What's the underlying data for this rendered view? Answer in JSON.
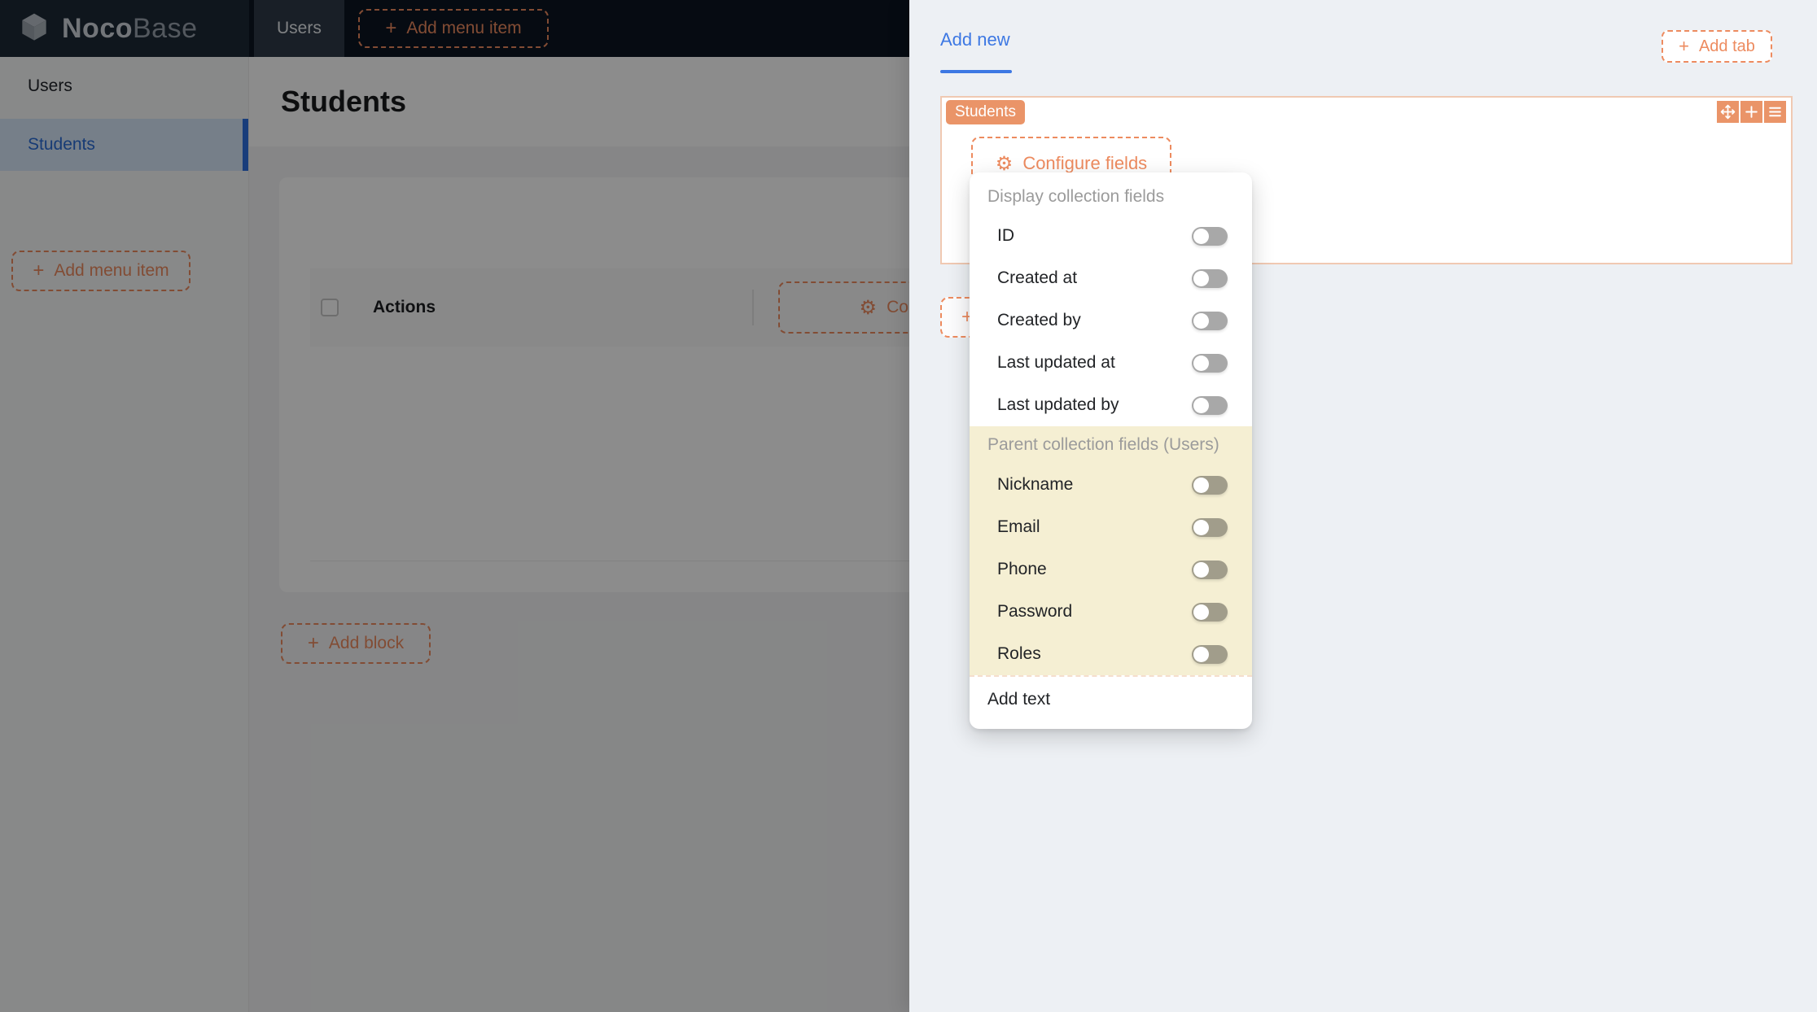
{
  "navbar": {
    "logo_bold": "Noco",
    "logo_light": "Base",
    "users_tab": "Users",
    "add_menu_item_label": "Add menu item"
  },
  "sidebar": {
    "items": [
      "Users",
      "Students"
    ],
    "selected_item": "Students",
    "add_menu_item_label": "Add menu item"
  },
  "main": {
    "page_title": "Students",
    "table": {
      "actions_header": "Actions",
      "configure_columns_label": "Configure c"
    },
    "add_block_label": "Add block"
  },
  "drawer": {
    "active_tab": "Add new",
    "add_tab_label": "Add tab",
    "block_badge": "Students",
    "configure_fields_label": "Configure fields"
  },
  "dropdown": {
    "section1": {
      "title": "Display collection fields",
      "items": [
        {
          "label": "ID",
          "enabled": false
        },
        {
          "label": "Created at",
          "enabled": false
        },
        {
          "label": "Created by",
          "enabled": false
        },
        {
          "label": "Last updated at",
          "enabled": false
        },
        {
          "label": "Last updated by",
          "enabled": false
        }
      ]
    },
    "section2": {
      "title": "Parent collection fields (Users)",
      "items": [
        {
          "label": "Nickname",
          "enabled": false
        },
        {
          "label": "Email",
          "enabled": false
        },
        {
          "label": "Phone",
          "enabled": false
        },
        {
          "label": "Password",
          "enabled": false
        },
        {
          "label": "Roles",
          "enabled": false
        }
      ]
    },
    "add_text_label": "Add text"
  },
  "icons": {
    "plus": "+",
    "gear": "⚙"
  },
  "colors": {
    "accent_orange": "#ed8b5f",
    "orange_fill": "#ea9468",
    "accent_blue": "#3d78e3",
    "navbar_bg": "#0c1522",
    "drawer_bg": "#edf0f4",
    "highlight_yellow": "#f5efd3",
    "selected_item_bg": "#d7e8f9"
  }
}
